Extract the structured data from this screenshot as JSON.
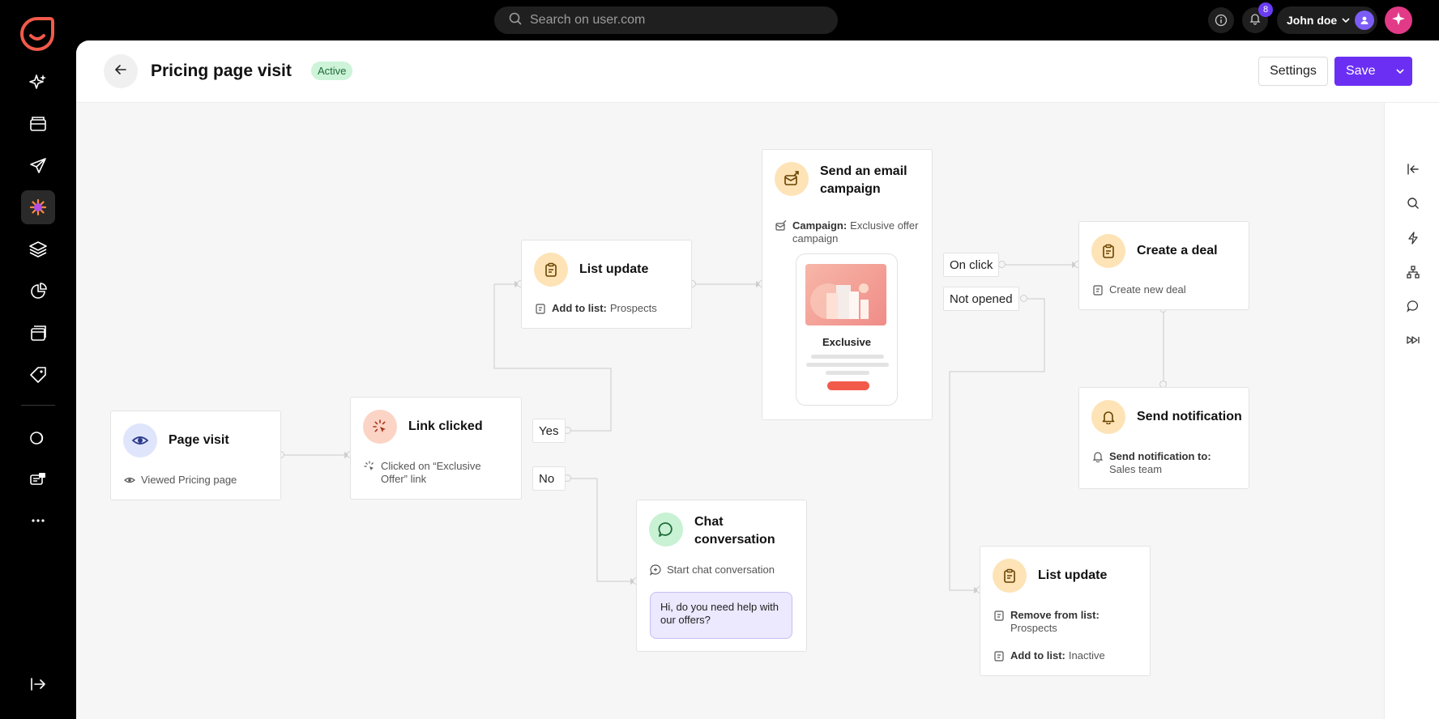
{
  "search": {
    "placeholder": "Search on user.com"
  },
  "topbar": {
    "notifications_count": "8",
    "user_name": "John doe"
  },
  "header": {
    "title": "Pricing page visit",
    "status": "Active",
    "settings_label": "Settings",
    "save_label": "Save"
  },
  "nodes": {
    "page_visit": {
      "title": "Page visit",
      "sub": "Viewed Pricing page"
    },
    "link_clicked": {
      "title": "Link clicked",
      "sub": "Clicked on “Exclusive Offer” link"
    },
    "list_update_1": {
      "title": "List update",
      "sub_label": "Add to list:",
      "sub_value": "Prospects"
    },
    "email_campaign": {
      "title": "Send an email campaign",
      "sub_label": "Campaign:",
      "sub_value": "Exclusive offer campaign",
      "preview_title": "Exclusive"
    },
    "create_deal": {
      "title": "Create a deal",
      "sub": "Create new deal"
    },
    "send_notification": {
      "title": "Send notification",
      "sub_label": "Send notification to:",
      "sub_value": "Sales team"
    },
    "chat": {
      "title": "Chat conversation",
      "sub": "Start chat conversation",
      "message": "Hi, do you need help with our offers?"
    },
    "list_update_2": {
      "title": "List update",
      "remove_label": "Remove from list:",
      "remove_value": "Prospects",
      "add_label": "Add to list:",
      "add_value": "Inactive"
    }
  },
  "branches": {
    "yes": "Yes",
    "no": "No",
    "on_click": "On click",
    "not_opened": "Not opened"
  },
  "icons": {
    "rail": [
      "sparkle-icon",
      "wallet-icon",
      "send-icon",
      "automation-icon",
      "layers-icon",
      "pie-chart-icon",
      "window-icon",
      "tag-icon",
      "coins-icon",
      "chat-stack-icon",
      "more-icon",
      "expand-rail-icon"
    ],
    "right_tools": [
      "collapse-panel-icon",
      "search-icon",
      "bolt-icon",
      "hierarchy-icon",
      "chat-icon",
      "forward-icon"
    ]
  },
  "colors": {
    "accent": "#6b2ff3",
    "brand": "#f25a4a",
    "active_badge": "#cdf3d8"
  }
}
